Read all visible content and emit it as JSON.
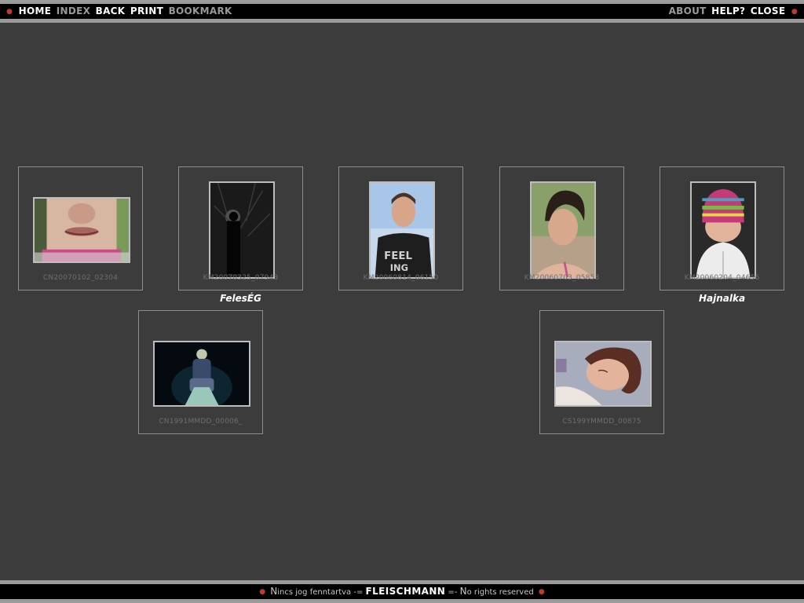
{
  "nav": {
    "left": [
      {
        "label": "HOME",
        "style": "bright"
      },
      {
        "label": "INDEX",
        "style": "dim"
      },
      {
        "label": "BACK",
        "style": "bright"
      },
      {
        "label": "PRINT",
        "style": "bright"
      },
      {
        "label": "BOOKMARK",
        "style": "dim"
      }
    ],
    "right": [
      {
        "label": "ABOUT",
        "style": "dim"
      },
      {
        "label": "HELP?",
        "style": "bright"
      },
      {
        "label": "CLOSE",
        "style": "bright"
      }
    ]
  },
  "footer": {
    "left_text_cap": "N",
    "left_text_rest": "incs jog fenntartva",
    "sep_left": " -= ",
    "brand": "FLEISCHMANN",
    "sep_right": " =- ",
    "right_text_cap": "N",
    "right_text_rest": "o rights reserved"
  },
  "thumbnails": [
    {
      "code": "CN20070102_02304",
      "tag": ""
    },
    {
      "code": "KM20070325_07943",
      "tag": "FelesÉG"
    },
    {
      "code": "KM20060814_06150",
      "tag": ""
    },
    {
      "code": "KM20060703_05853",
      "tag": ""
    },
    {
      "code": "KM20060204_04656",
      "tag": "Hajnalka"
    },
    {
      "code": "CN1991MMDD_00006_",
      "tag": ""
    },
    {
      "code": "CS199YMMDD_00875",
      "tag": ""
    }
  ],
  "colors": {
    "background": "#3c3c3c",
    "bar": "#000000",
    "frame": "#9a9a9a",
    "accent_dot": "#c0392b"
  }
}
